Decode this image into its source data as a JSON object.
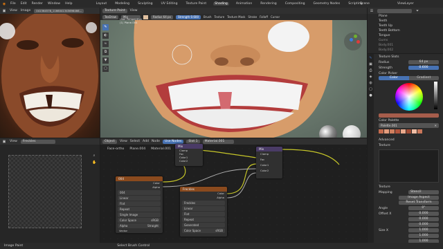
{
  "menu": {
    "items": [
      "File",
      "Edit",
      "Render",
      "Window",
      "Help"
    ]
  },
  "workspaces": {
    "tabs": [
      "Layout",
      "Modeling",
      "Sculpting",
      "UV Editing",
      "Texture Paint",
      "Shading",
      "Animation",
      "Rendering",
      "Compositing",
      "Geometry Nodes",
      "Scripting"
    ],
    "active": "Shading"
  },
  "scene": {
    "label": "Scene",
    "view_layer": "ViewLayer"
  },
  "image_editor": {
    "view": "View",
    "image": "Image",
    "filename": "041364578_1166041345696466..."
  },
  "viewport": {
    "mode": "Texture Paint",
    "view": "View",
    "brush": "TexDraw",
    "blend": "Mix",
    "radius_label": "Radius",
    "radius_value": "64 px",
    "strength_label": "Strength",
    "strength_value": "0.600",
    "brush_menu": "Brush",
    "texture_menu": "Texture",
    "texture_mask_menu": "Texture Mask",
    "stroke_menu": "Stroke",
    "falloff_menu": "Falloff",
    "cursor_menu": "Cursor",
    "overlay_line1": "User Perspective",
    "overlay_line2": "(1) Plane.004"
  },
  "image_editor2": {
    "view": "View",
    "image": "Freckles"
  },
  "node_editor": {
    "object": "Object",
    "view": "View",
    "select": "Select",
    "add": "Add",
    "node": "Node",
    "use_nodes": "Use Nodes",
    "slot": "Slot 1",
    "material": "Material.001",
    "breadcrumb": [
      "Face-ortho",
      "Plane.004",
      "Material.001"
    ]
  },
  "nodes": {
    "mix": {
      "title": "Mix",
      "rows": [
        "Clamp",
        "Fac",
        "Color1",
        "Color2"
      ]
    },
    "mix2": {
      "title": "Mix",
      "rows": [
        "Clamp",
        "Fac",
        "Color1",
        "Color2"
      ]
    },
    "tex1": {
      "title": "004",
      "image": "004",
      "interp": "Linear",
      "proj": "Flat",
      "ext": "Repeat",
      "source": "Single Image",
      "cs_label": "Color Space",
      "cs": "sRGB",
      "alpha_label": "Alpha",
      "alpha": "Straight",
      "out_color": "Color",
      "out_alpha": "Alpha",
      "vector": "Vector"
    },
    "tex2": {
      "title": "Freckles",
      "image": "Freckles",
      "interp": "Linear",
      "proj": "Flat",
      "ext": "Repeat",
      "source": "Generated",
      "out_color": "Color",
      "out_alpha": "Alpha",
      "cs_label": "Color Space",
      "cs": "sRGB"
    }
  },
  "outliner": {
    "items": [
      "Plane",
      "Teeth",
      "Teeth Up",
      "Teeth Bottom",
      "Tongue",
      "Gums",
      "Body.001",
      "Body.002"
    ]
  },
  "props": {
    "texture_slots": "Texture Slots",
    "radius_label": "Radius",
    "radius": "64 px",
    "strength_label": "Strength",
    "strength": "0.600",
    "color_picker": "Color Picker",
    "tab_color": "Color",
    "tab_gradient": "Gradient",
    "color_palette": "Color Palette",
    "palette_name": "Palette.001",
    "advanced": "Advanced",
    "texture": "Texture",
    "texture_label": "Texture",
    "mapping_label": "Mapping",
    "mapping": "Stencil",
    "image_aspect": "Image Aspect",
    "reset_transform": "Reset Transform",
    "angle_label": "Angle",
    "angle": "0°",
    "offset_label": "Offset X",
    "offset_x": "0.000",
    "offset_y": "0.000",
    "offset_z": "0.000",
    "size_label": "Size X",
    "size_x": "1.000",
    "size_y": "1.000",
    "size_z": "1.000"
  },
  "status": {
    "left": "Image Paint",
    "mid": "Select Brush Control",
    "right": "Blender 3.x"
  }
}
